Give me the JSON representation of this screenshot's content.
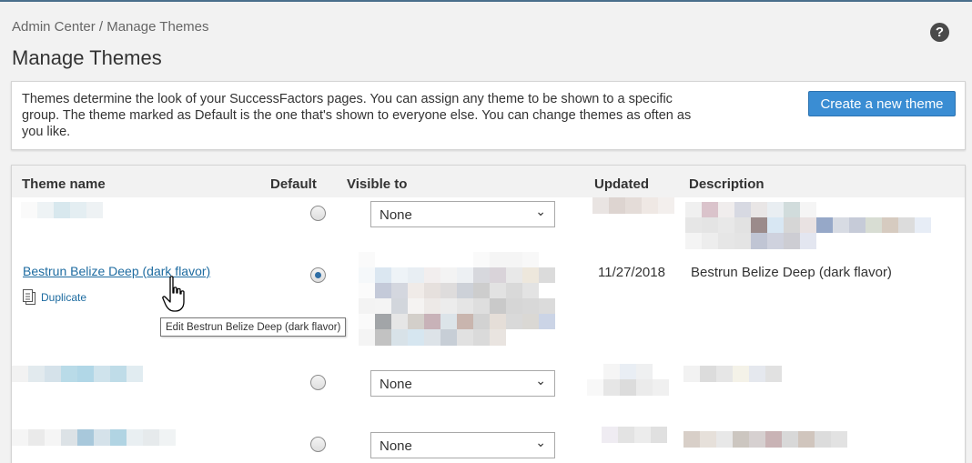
{
  "breadcrumb": "Admin Center / Manage Themes",
  "page_title": "Manage Themes",
  "help_label": "?",
  "info": {
    "text": "Themes determine the look of your SuccessFactors pages. You can assign any theme to be shown to a specific group. The theme marked as Default is the one that's shown to everyone else. You can change themes as often as you like.",
    "create_button": "Create a new theme"
  },
  "table": {
    "headers": {
      "theme_name": "Theme name",
      "default": "Default",
      "visible_to": "Visible to",
      "updated": "Updated",
      "description": "Description"
    },
    "rows": [
      {
        "visible_to": "None",
        "default": false
      },
      {
        "theme_name": "Bestrun Belize Deep (dark flavor)",
        "duplicate_label": "Duplicate",
        "updated": "11/27/2018",
        "description": "Bestrun Belize Deep (dark flavor)",
        "default": true
      },
      {
        "visible_to": "None",
        "default": false
      },
      {
        "visible_to": "None",
        "default": false
      }
    ]
  },
  "tooltip": "Edit Bestrun Belize Deep (dark flavor)"
}
